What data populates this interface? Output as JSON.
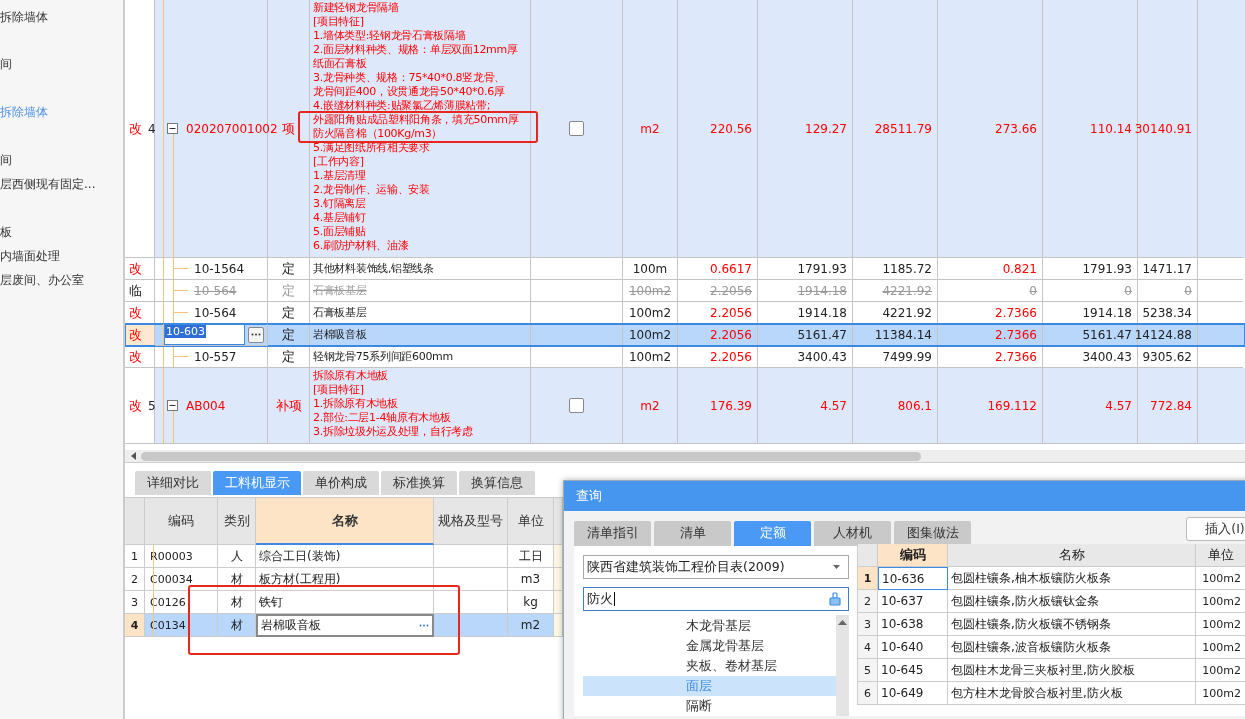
{
  "sidebar": {
    "items": [
      {
        "label": "拆除墙体",
        "selected": false
      },
      {
        "label": "间",
        "selected": false
      },
      {
        "label": "拆除墙体",
        "selected": true
      },
      {
        "label": "间",
        "selected": false
      },
      {
        "label": "层西侧现有固定...",
        "selected": false
      },
      {
        "label": "板",
        "selected": false
      },
      {
        "label": "内墙面处理",
        "selected": false
      },
      {
        "label": "层废间、办公室",
        "selected": false
      }
    ]
  },
  "main_table": {
    "rows": [
      {
        "kind": "item",
        "flag": "改",
        "changed": true,
        "number": "4",
        "expanded": true,
        "code": "020207001002",
        "type": "项",
        "name": [
          "新建轻钢龙骨隔墙",
          "[项目特征]",
          "1.墙体类型:轻钢龙骨石膏板隔墙",
          "2.面层材料种类、规格：单层双面12mm厚",
          "纸面石膏板",
          "3.龙骨种类、规格：75*40*0.8竖龙骨、",
          "龙骨间距400，设贯通龙骨50*40*0.6厚",
          "4.嵌缝材料种类:贴聚氯乙烯薄膜粘带;",
          "外露阳角贴成品塑料阳角条，填充50mm厚",
          "防火隔音棉（100Kg/m3）",
          "5.满足图纸所有相关要求",
          "[工作内容]",
          "1.基层清理",
          "2.龙骨制作、运输、安装",
          "3.钉隔离层",
          "4.基层铺钉",
          "5.面层铺贴",
          "6.刷防护材料、油漆"
        ],
        "checked": false,
        "unit": "m2",
        "values": [
          {
            "text": "220.56",
            "highlight": true
          },
          {
            "text": "129.27",
            "highlight": true
          },
          {
            "text": "28511.79",
            "highlight": true
          },
          {
            "text": "273.66",
            "highlight": true
          },
          {
            "text": "110.14",
            "highlight": true
          },
          {
            "text": "30140.91",
            "highlight": true
          }
        ],
        "selected": false,
        "struck": false
      },
      {
        "kind": "quota",
        "flag": "改",
        "changed": true,
        "code": "10-1564",
        "type": "定",
        "name": [
          "其他材料装饰线,铝塑线条"
        ],
        "unit": "100m",
        "values": [
          {
            "text": "0.6617",
            "highlight": true
          },
          {
            "text": "1791.93",
            "highlight": false
          },
          {
            "text": "1185.72",
            "highlight": false
          },
          {
            "text": "0.821",
            "highlight": true
          },
          {
            "text": "1791.93",
            "highlight": false
          },
          {
            "text": "1471.17",
            "highlight": false
          }
        ],
        "selected": false,
        "struck": false
      },
      {
        "kind": "quota",
        "flag": "临",
        "changed": false,
        "code": "10-564",
        "type": "定",
        "name": [
          "石膏板基层"
        ],
        "unit": "100m2",
        "values": [
          {
            "text": "2.2056"
          },
          {
            "text": "1914.18"
          },
          {
            "text": "4221.92"
          },
          {
            "text": "0"
          },
          {
            "text": "0"
          },
          {
            "text": "0"
          }
        ],
        "selected": false,
        "struck": true
      },
      {
        "kind": "quota",
        "flag": "改",
        "changed": true,
        "code": "10-564",
        "type": "定",
        "name": [
          "石膏板基层"
        ],
        "unit": "100m2",
        "values": [
          {
            "text": "2.2056",
            "highlight": true
          },
          {
            "text": "1914.18",
            "highlight": false
          },
          {
            "text": "4221.92",
            "highlight": false
          },
          {
            "text": "2.7366",
            "highlight": true
          },
          {
            "text": "1914.18",
            "highlight": false
          },
          {
            "text": "5238.34",
            "highlight": false
          }
        ],
        "selected": false,
        "struck": false
      },
      {
        "kind": "quota",
        "flag": "改",
        "changed": true,
        "code": "10-603",
        "type": "定",
        "name": [
          "岩棉吸音板"
        ],
        "unit": "100m2",
        "values": [
          {
            "text": "2.2056",
            "highlight": true
          },
          {
            "text": "5161.47",
            "highlight": false
          },
          {
            "text": "11384.14",
            "highlight": false
          },
          {
            "text": "2.7366",
            "highlight": true
          },
          {
            "text": "5161.47",
            "highlight": false
          },
          {
            "text": "14124.88",
            "highlight": false
          }
        ],
        "selected": true,
        "struck": false
      },
      {
        "kind": "quota",
        "flag": "改",
        "changed": true,
        "code": "10-557",
        "type": "定",
        "name": [
          "轻钢龙骨75系列间距600mm"
        ],
        "unit": "100m2",
        "values": [
          {
            "text": "2.2056",
            "highlight": true
          },
          {
            "text": "3400.43",
            "highlight": false
          },
          {
            "text": "7499.99",
            "highlight": false
          },
          {
            "text": "2.7366",
            "highlight": true
          },
          {
            "text": "3400.43",
            "highlight": false
          },
          {
            "text": "9305.62",
            "highlight": false
          }
        ],
        "selected": false,
        "struck": false
      },
      {
        "kind": "item",
        "flag": "改",
        "changed": true,
        "number": "5",
        "expanded": true,
        "code": "AB004",
        "type": "补项",
        "name": [
          "拆除原有木地板",
          "[项目特征]",
          "1.拆除原有木地板",
          "2.部位:二层1-4轴原有木地板",
          "3.拆除垃圾外运及处理，自行考虑"
        ],
        "checked": false,
        "unit": "m2",
        "values": [
          {
            "text": "176.39",
            "highlight": true
          },
          {
            "text": "4.57",
            "highlight": true
          },
          {
            "text": "806.1",
            "highlight": true
          },
          {
            "text": "169.112",
            "highlight": true
          },
          {
            "text": "4.57",
            "highlight": true
          },
          {
            "text": "772.84",
            "highlight": true
          }
        ],
        "selected": false,
        "struck": false
      }
    ]
  },
  "bottom_panel": {
    "tabs": [
      {
        "label": "详细对比",
        "selected": false
      },
      {
        "label": "工料机显示",
        "selected": true
      },
      {
        "label": "单价构成",
        "selected": false
      },
      {
        "label": "标准换算",
        "selected": false
      },
      {
        "label": "换算信息",
        "selected": false
      }
    ],
    "columns": [
      {
        "label": "编码",
        "selected": false
      },
      {
        "label": "类别",
        "selected": false
      },
      {
        "label": "名称",
        "selected": true
      },
      {
        "label": "规格及型号",
        "selected": false
      },
      {
        "label": "单位",
        "selected": false
      }
    ],
    "rows": [
      {
        "number": "1",
        "code": "R00003",
        "category": "人",
        "name": "综合工日(装饰)",
        "unit": "工日",
        "selected": false
      },
      {
        "number": "2",
        "code": "C00034",
        "category": "材",
        "name": "板方材(工程用)",
        "unit": "m3",
        "selected": false
      },
      {
        "number": "3",
        "code": "C0126",
        "category": "材",
        "name": "铁钉",
        "unit": "kg",
        "selected": false
      },
      {
        "number": "4",
        "code": "C0134",
        "category": "材",
        "name": "岩棉吸音板",
        "unit": "m2",
        "selected": true
      }
    ]
  },
  "dialog": {
    "title": "查询",
    "tabs": [
      {
        "label": "清单指引",
        "selected": false
      },
      {
        "label": "清单",
        "selected": false
      },
      {
        "label": "定额",
        "selected": true
      },
      {
        "label": "人材机",
        "selected": false
      },
      {
        "label": "图集做法",
        "selected": false
      }
    ],
    "insert_button": "插入(I)",
    "library": "陕西省建筑装饰工程价目表(2009)",
    "search": "防火",
    "tree": [
      {
        "label": "木龙骨基层",
        "selected": false
      },
      {
        "label": "金属龙骨基层",
        "selected": false
      },
      {
        "label": "夹板、卷材基层",
        "selected": false
      },
      {
        "label": "面层",
        "selected": true
      },
      {
        "label": "隔断",
        "selected": false
      }
    ],
    "columns": [
      {
        "label": "编码",
        "selected": true
      },
      {
        "label": "名称",
        "selected": false
      },
      {
        "label": "单位",
        "selected": false
      }
    ],
    "rows": [
      {
        "number": "1",
        "code": "10-636",
        "name": "包圆柱镶条,柚木板镶防火板条",
        "unit": "100m2",
        "selected": true
      },
      {
        "number": "2",
        "code": "10-637",
        "name": "包圆柱镶条,防火板镶钛金条",
        "unit": "100m2",
        "selected": false
      },
      {
        "number": "3",
        "code": "10-638",
        "name": "包圆柱镶条,防火板镶不锈钢条",
        "unit": "100m2",
        "selected": false
      },
      {
        "number": "4",
        "code": "10-640",
        "name": "包圆柱镶条,波音板镶防火板条",
        "unit": "100m2",
        "selected": false
      },
      {
        "number": "5",
        "code": "10-645",
        "name": "包圆柱木龙骨三夹板衬里,防火胶板",
        "unit": "100m2",
        "selected": false
      },
      {
        "number": "6",
        "code": "10-649",
        "name": "包方柱木龙骨胶合板衬里,防火板",
        "unit": "100m2",
        "selected": false
      }
    ]
  }
}
